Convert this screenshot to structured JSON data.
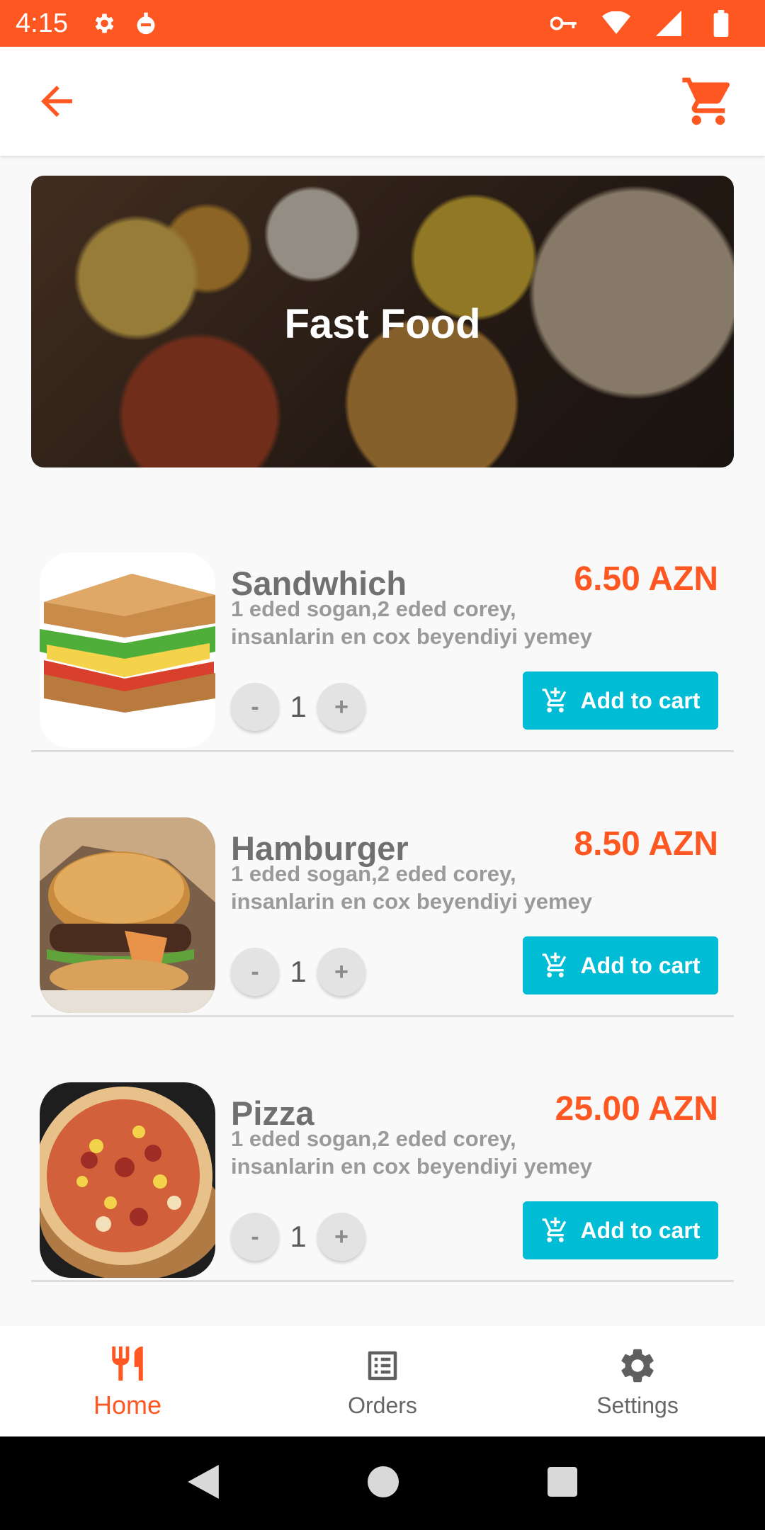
{
  "status_bar": {
    "time": "4:15",
    "icons": [
      "settings-icon",
      "notification-icon",
      "vpn-key-icon",
      "wifi-icon",
      "signal-icon",
      "battery-icon"
    ]
  },
  "app_bar": {
    "back_icon": "arrow-left-icon",
    "cart_icon": "cart-icon"
  },
  "banner": {
    "title": "Fast Food"
  },
  "products": [
    {
      "name": "Sandwhich",
      "price": "6.50 AZN",
      "description_line1": "1 eded sogan,2 eded corey,",
      "description_line2": "insanlarin en cox beyendiyi yemey",
      "quantity": "1",
      "minus_label": "-",
      "plus_label": "+",
      "add_label": "Add to cart"
    },
    {
      "name": "Hamburger",
      "price": "8.50 AZN",
      "description_line1": "1 eded sogan,2 eded corey,",
      "description_line2": "insanlarin en cox beyendiyi yemey",
      "quantity": "1",
      "minus_label": "-",
      "plus_label": "+",
      "add_label": "Add to cart"
    },
    {
      "name": "Pizza",
      "price": "25.00 AZN",
      "description_line1": "1 eded sogan,2 eded corey,",
      "description_line2": "insanlarin en cox beyendiyi yemey",
      "quantity": "1",
      "minus_label": "-",
      "plus_label": "+",
      "add_label": "Add to cart"
    }
  ],
  "bottom_nav": {
    "items": [
      {
        "label": "Home",
        "icon": "restaurant-icon",
        "active": true
      },
      {
        "label": "Orders",
        "icon": "list-icon",
        "active": false
      },
      {
        "label": "Settings",
        "icon": "gear-icon",
        "active": false
      }
    ]
  },
  "colors": {
    "accent": "#ff5722",
    "button": "#00bcd4"
  }
}
